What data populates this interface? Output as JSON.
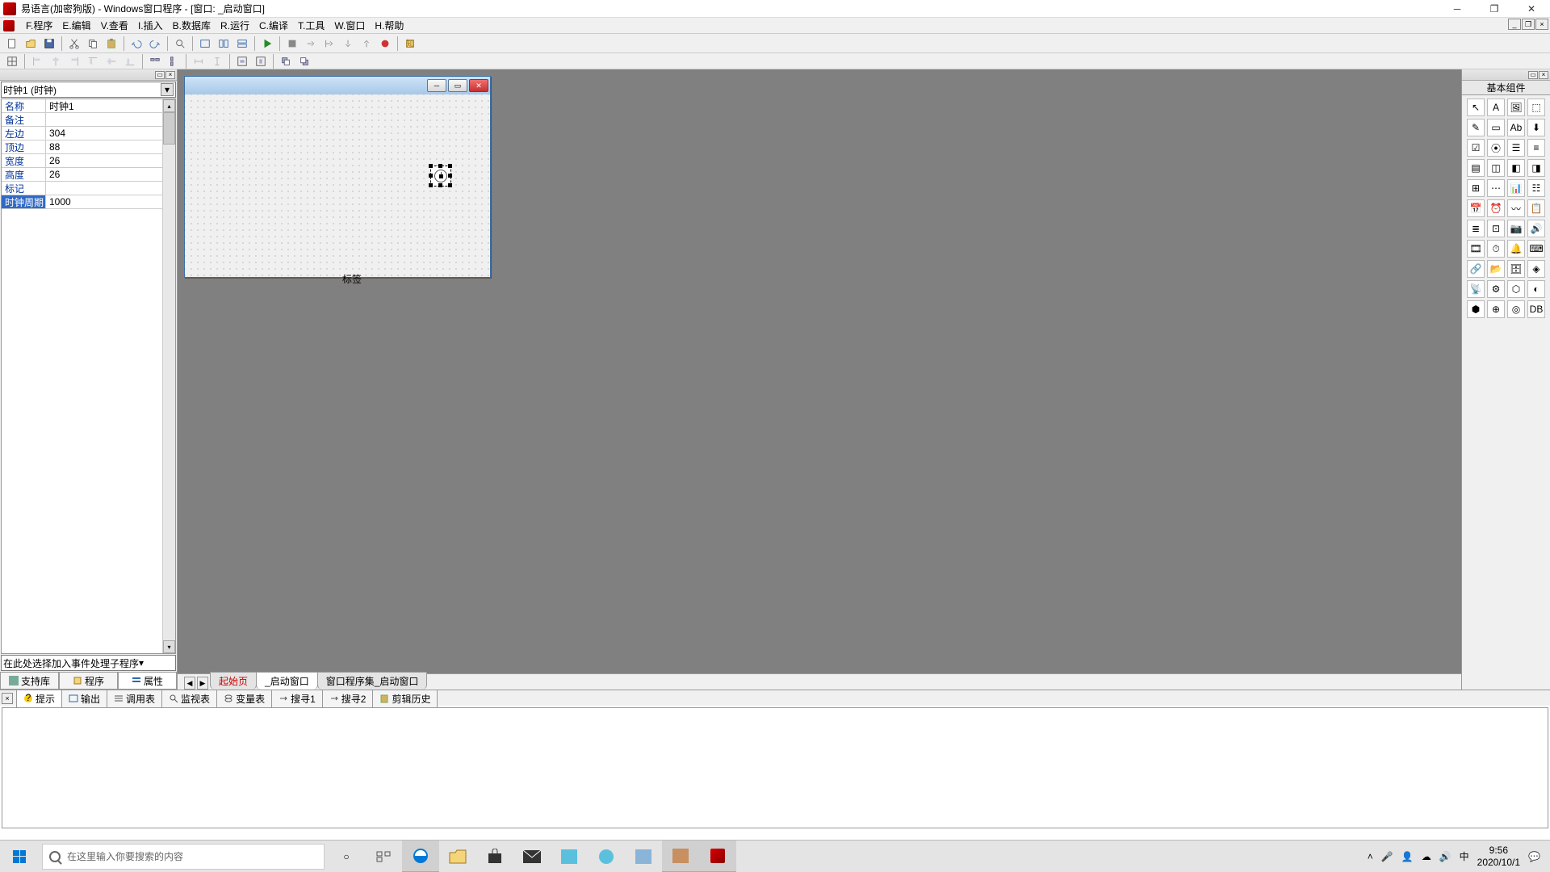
{
  "title": "易语言(加密狗版) - Windows窗口程序 - [窗口: _启动窗口]",
  "menu": [
    "F.程序",
    "E.编辑",
    "V.查看",
    "I.插入",
    "B.数据库",
    "R.运行",
    "C.编译",
    "T.工具",
    "W.窗口",
    "H.帮助"
  ],
  "left": {
    "combo": "时钟1 (时钟)",
    "props": [
      {
        "k": "名称",
        "v": "时钟1"
      },
      {
        "k": "备注",
        "v": ""
      },
      {
        "k": "左边",
        "v": "304"
      },
      {
        "k": "顶边",
        "v": "88"
      },
      {
        "k": "宽度",
        "v": "26"
      },
      {
        "k": "高度",
        "v": "26"
      },
      {
        "k": "标记",
        "v": ""
      },
      {
        "k": "时钟周期",
        "v": "1000"
      }
    ],
    "event_combo": "在此处选择加入事件处理子程序",
    "tabs": [
      "支持库",
      "程序",
      "属性"
    ]
  },
  "form": {
    "label_text": "标签"
  },
  "doc_tabs": [
    "起始页",
    "_启动窗口",
    "窗口程序集_启动窗口"
  ],
  "right": {
    "title": "基本组件"
  },
  "bottom_tabs": [
    "提示",
    "输出",
    "调用表",
    "监视表",
    "变量表",
    "搜寻1",
    "搜寻2",
    "剪辑历史"
  ],
  "taskbar": {
    "search_placeholder": "在这里输入你要搜索的内容",
    "time": "9:56",
    "date": "2020/10/1",
    "ime": "中"
  }
}
